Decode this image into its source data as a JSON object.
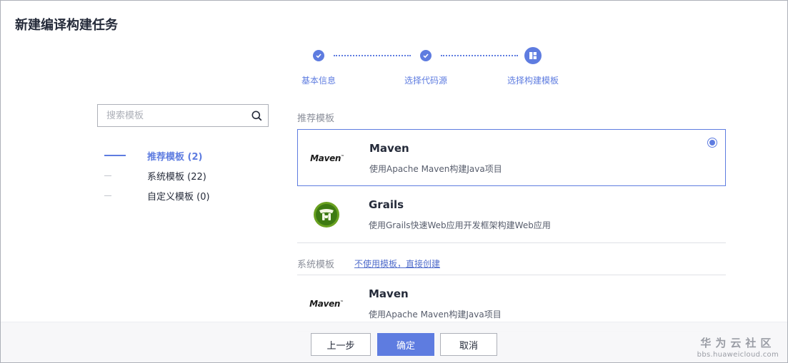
{
  "dialog": {
    "title": "新建编译构建任务"
  },
  "steps": [
    {
      "label": "基本信息",
      "state": "done"
    },
    {
      "label": "选择代码源",
      "state": "done"
    },
    {
      "label": "选择构建模板",
      "state": "current"
    }
  ],
  "search": {
    "placeholder": "搜索模板",
    "value": ""
  },
  "categories": [
    {
      "label": "推荐模板 (2)",
      "active": true
    },
    {
      "label": "系统模板 (22)",
      "active": false
    },
    {
      "label": "自定义模板 (0)",
      "active": false
    }
  ],
  "recommended": {
    "section_label": "推荐模板",
    "templates": [
      {
        "logo_text": "Maven",
        "name": "Maven",
        "desc": "使用Apache Maven构建Java项目",
        "selected": true
      },
      {
        "logo_text": "",
        "name": "Grails",
        "desc": "使用Grails快速Web应用开发框架构建Web应用",
        "selected": false
      }
    ]
  },
  "system": {
    "section_label": "系统模板",
    "link_label": "不使用模板，直接创建",
    "templates": [
      {
        "logo_text": "Maven",
        "name": "Maven",
        "desc": "使用Apache Maven构建Java项目"
      }
    ]
  },
  "footer": {
    "prev_label": "上一步",
    "ok_label": "确定",
    "cancel_label": "取消"
  },
  "watermark": {
    "title": "华为云社区",
    "url": "bbs.huaweicloud.com"
  },
  "colors": {
    "accent": "#5e7ce0",
    "grails_green": "#6aa121"
  },
  "icons": {
    "search": "search-icon",
    "check": "check-icon",
    "template": "template-grid-icon",
    "grails": "grails-logo-icon"
  }
}
